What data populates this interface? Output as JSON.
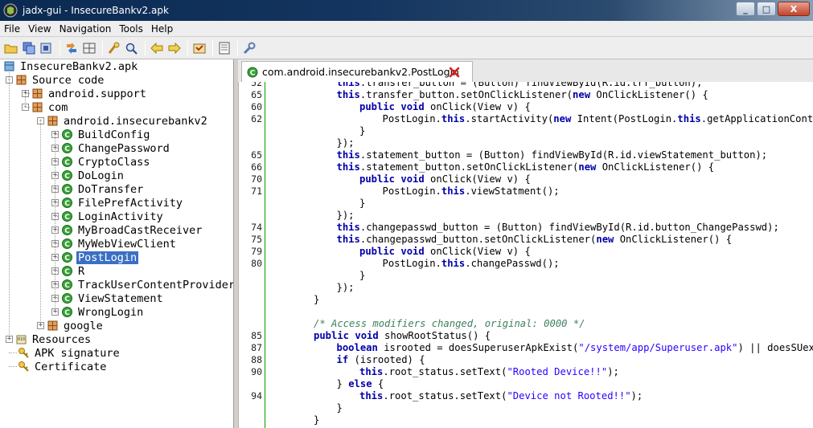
{
  "window": {
    "title": "jadx-gui - InsecureBankv2.apk",
    "min_label": "_",
    "max_label": "□",
    "close_label": "X"
  },
  "menu": [
    "File",
    "View",
    "Navigation",
    "Tools",
    "Help"
  ],
  "toolbar": [
    "open-folder",
    "save-all",
    "export",
    "sync",
    "flatten",
    "find",
    "search",
    "back",
    "forward",
    "deobf",
    "log",
    "settings"
  ],
  "tree": {
    "root": "InsecureBankv2.apk",
    "source_code": "Source code",
    "android_support": "android.support",
    "com": "com",
    "package": "android.insecurebankv2",
    "classes": [
      "BuildConfig",
      "ChangePassword",
      "CryptoClass",
      "DoLogin",
      "DoTransfer",
      "FilePrefActivity",
      "LoginActivity",
      "MyBroadCastReceiver",
      "MyWebViewClient",
      "PostLogin",
      "R",
      "TrackUserContentProvider",
      "ViewStatement",
      "WrongLogin"
    ],
    "selected": "PostLogin",
    "google": "google",
    "resources": "Resources",
    "apk_signature": "APK signature",
    "certificate": "Certificate"
  },
  "editor": {
    "tab_label": "com.android.insecurebankv2.PostLogin",
    "lines": [
      {
        "n": "52",
        "i": 3,
        "parts": [
          [
            "kw",
            "this"
          ],
          [
            "id",
            ".transfer_button = (Button) findViewById(R.id.trf_button);"
          ]
        ]
      },
      {
        "n": "65",
        "i": 3,
        "parts": [
          [
            "kw",
            "this"
          ],
          [
            "id",
            ".transfer_button.setOnClickListener("
          ],
          [
            "kw",
            "new"
          ],
          [
            "id",
            " OnClickListener() {"
          ]
        ]
      },
      {
        "n": "60",
        "i": 4,
        "parts": [
          [
            "kw",
            "public void"
          ],
          [
            "id",
            " onClick(View v) {"
          ]
        ]
      },
      {
        "n": "62",
        "i": 5,
        "parts": [
          [
            "id",
            "PostLogin."
          ],
          [
            "kw",
            "this"
          ],
          [
            "id",
            ".startActivity("
          ],
          [
            "kw",
            "new"
          ],
          [
            "id",
            " Intent(PostLogin."
          ],
          [
            "kw",
            "this"
          ],
          [
            "id",
            ".getApplicationContext(),"
          ]
        ]
      },
      {
        "n": "",
        "i": 4,
        "parts": [
          [
            "id",
            "}"
          ]
        ]
      },
      {
        "n": "",
        "i": 3,
        "parts": [
          [
            "id",
            "});"
          ]
        ]
      },
      {
        "n": "65",
        "i": 3,
        "parts": [
          [
            "kw",
            "this"
          ],
          [
            "id",
            ".statement_button = (Button) findViewById(R.id.viewStatement_button);"
          ]
        ]
      },
      {
        "n": "66",
        "i": 3,
        "parts": [
          [
            "kw",
            "this"
          ],
          [
            "id",
            ".statement_button.setOnClickListener("
          ],
          [
            "kw",
            "new"
          ],
          [
            "id",
            " OnClickListener() {"
          ]
        ]
      },
      {
        "n": "70",
        "i": 4,
        "parts": [
          [
            "kw",
            "public void"
          ],
          [
            "id",
            " onClick(View v) {"
          ]
        ]
      },
      {
        "n": "71",
        "i": 5,
        "parts": [
          [
            "id",
            "PostLogin."
          ],
          [
            "kw",
            "this"
          ],
          [
            "id",
            ".viewStatment();"
          ]
        ]
      },
      {
        "n": "",
        "i": 4,
        "parts": [
          [
            "id",
            "}"
          ]
        ]
      },
      {
        "n": "",
        "i": 3,
        "parts": [
          [
            "id",
            "});"
          ]
        ]
      },
      {
        "n": "74",
        "i": 3,
        "parts": [
          [
            "kw",
            "this"
          ],
          [
            "id",
            ".changepasswd_button = (Button) findViewById(R.id.button_ChangePasswd);"
          ]
        ]
      },
      {
        "n": "75",
        "i": 3,
        "parts": [
          [
            "kw",
            "this"
          ],
          [
            "id",
            ".changepasswd_button.setOnClickListener("
          ],
          [
            "kw",
            "new"
          ],
          [
            "id",
            " OnClickListener() {"
          ]
        ]
      },
      {
        "n": "79",
        "i": 4,
        "parts": [
          [
            "kw",
            "public void"
          ],
          [
            "id",
            " onClick(View v) {"
          ]
        ]
      },
      {
        "n": "80",
        "i": 5,
        "parts": [
          [
            "id",
            "PostLogin."
          ],
          [
            "kw",
            "this"
          ],
          [
            "id",
            ".changePasswd();"
          ]
        ]
      },
      {
        "n": "",
        "i": 4,
        "parts": [
          [
            "id",
            "}"
          ]
        ]
      },
      {
        "n": "",
        "i": 3,
        "parts": [
          [
            "id",
            "});"
          ]
        ]
      },
      {
        "n": "",
        "i": 2,
        "parts": [
          [
            "id",
            "}"
          ]
        ]
      },
      {
        "n": "",
        "i": 0,
        "parts": []
      },
      {
        "n": "",
        "i": 2,
        "parts": [
          [
            "cmt",
            "/* Access modifiers changed, original: 0000 */"
          ]
        ]
      },
      {
        "n": "85",
        "i": 2,
        "parts": [
          [
            "kw",
            "public void"
          ],
          [
            "id",
            " showRootStatus() {"
          ]
        ]
      },
      {
        "n": "87",
        "i": 3,
        "parts": [
          [
            "kw",
            "boolean"
          ],
          [
            "id",
            " isrooted = doesSuperuserApkExist("
          ],
          [
            "str",
            "\"/system/app/Superuser.apk\""
          ],
          [
            "id",
            ") || doesSUexist();"
          ]
        ]
      },
      {
        "n": "88",
        "i": 3,
        "parts": [
          [
            "kw",
            "if"
          ],
          [
            "id",
            " (isrooted) {"
          ]
        ]
      },
      {
        "n": "90",
        "i": 4,
        "parts": [
          [
            "kw",
            "this"
          ],
          [
            "id",
            ".root_status.setText("
          ],
          [
            "str",
            "\"Rooted Device!!\""
          ],
          [
            "id",
            ");"
          ]
        ]
      },
      {
        "n": "",
        "i": 3,
        "parts": [
          [
            "id",
            "} "
          ],
          [
            "kw",
            "else"
          ],
          [
            "id",
            " {"
          ]
        ]
      },
      {
        "n": "94",
        "i": 4,
        "parts": [
          [
            "kw",
            "this"
          ],
          [
            "id",
            ".root_status.setText("
          ],
          [
            "str",
            "\"Device not Rooted!!\""
          ],
          [
            "id",
            ");"
          ]
        ]
      },
      {
        "n": "",
        "i": 3,
        "parts": [
          [
            "id",
            "}"
          ]
        ]
      },
      {
        "n": "",
        "i": 2,
        "parts": [
          [
            "id",
            "}"
          ]
        ]
      }
    ]
  }
}
